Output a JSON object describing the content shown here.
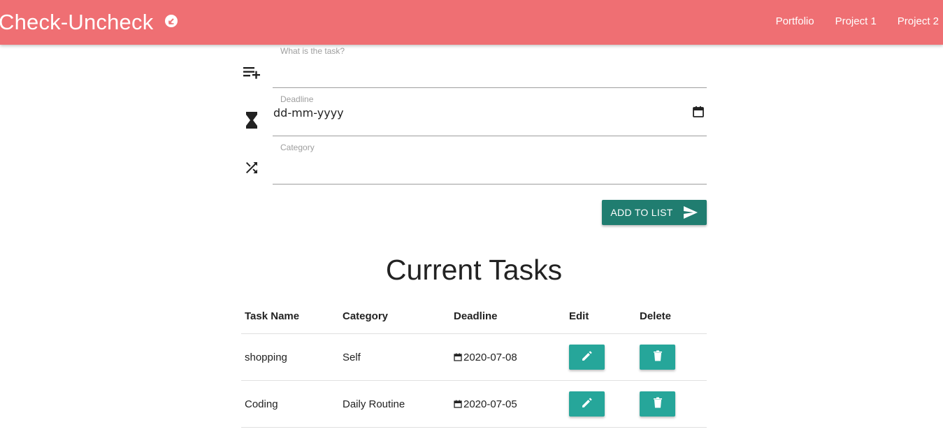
{
  "navbar": {
    "brand": "Check-Uncheck",
    "brand_icon": "check-circle-icon",
    "links": [
      "Portfolio",
      "Project 1",
      "Project 2"
    ],
    "color": "#ef6f73"
  },
  "form": {
    "task": {
      "label": "What is the task?",
      "value": "",
      "icon": "playlist-add-icon"
    },
    "deadline": {
      "label": "Deadline",
      "value": "dd-mm-yyyy",
      "icon": "hourglass-icon",
      "picker_icon": "calendar-icon"
    },
    "category": {
      "label": "Category",
      "value": "",
      "icon": "shuffle-icon"
    },
    "submit": {
      "label": "ADD TO LIST",
      "icon": "send-icon",
      "color": "#207d70"
    }
  },
  "tasks": {
    "title": "Current Tasks",
    "headers": [
      "Task Name",
      "Category",
      "Deadline",
      "Edit",
      "Delete"
    ],
    "rows": [
      {
        "name": "shopping",
        "category": "Self",
        "deadline": "2020-07-08"
      },
      {
        "name": "Coding",
        "category": "Daily Routine",
        "deadline": "2020-07-05"
      }
    ],
    "edit_icon": "pencil-icon",
    "delete_icon": "trash-icon",
    "button_color": "#26a69a"
  }
}
